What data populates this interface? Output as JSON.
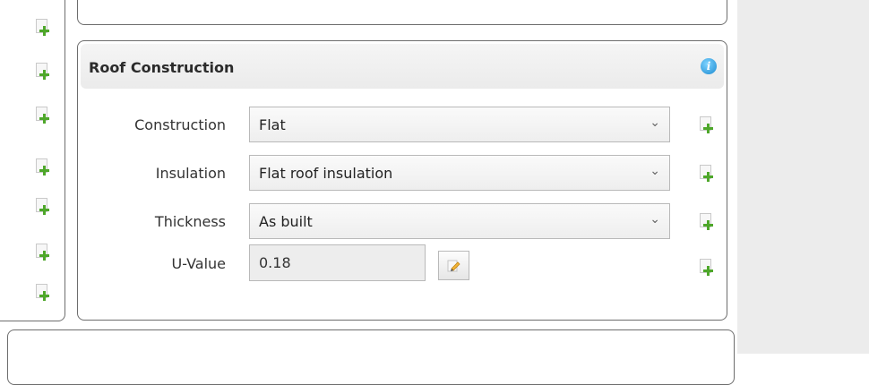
{
  "section": {
    "title": "Roof Construction",
    "info_icon": "info-icon"
  },
  "fields": {
    "construction": {
      "label": "Construction",
      "value": "Flat"
    },
    "insulation": {
      "label": "Insulation",
      "value": "Flat roof insulation"
    },
    "thickness": {
      "label": "Thickness",
      "value": "As built"
    },
    "uvalue": {
      "label": "U-Value",
      "value": "0.18"
    }
  },
  "icons": {
    "add": "add-document-icon",
    "edit": "edit-pencil-icon",
    "dropdown": "chevron-down-icon"
  },
  "colors": {
    "plus": "#4ea72a",
    "info": "#1d8bd1"
  }
}
